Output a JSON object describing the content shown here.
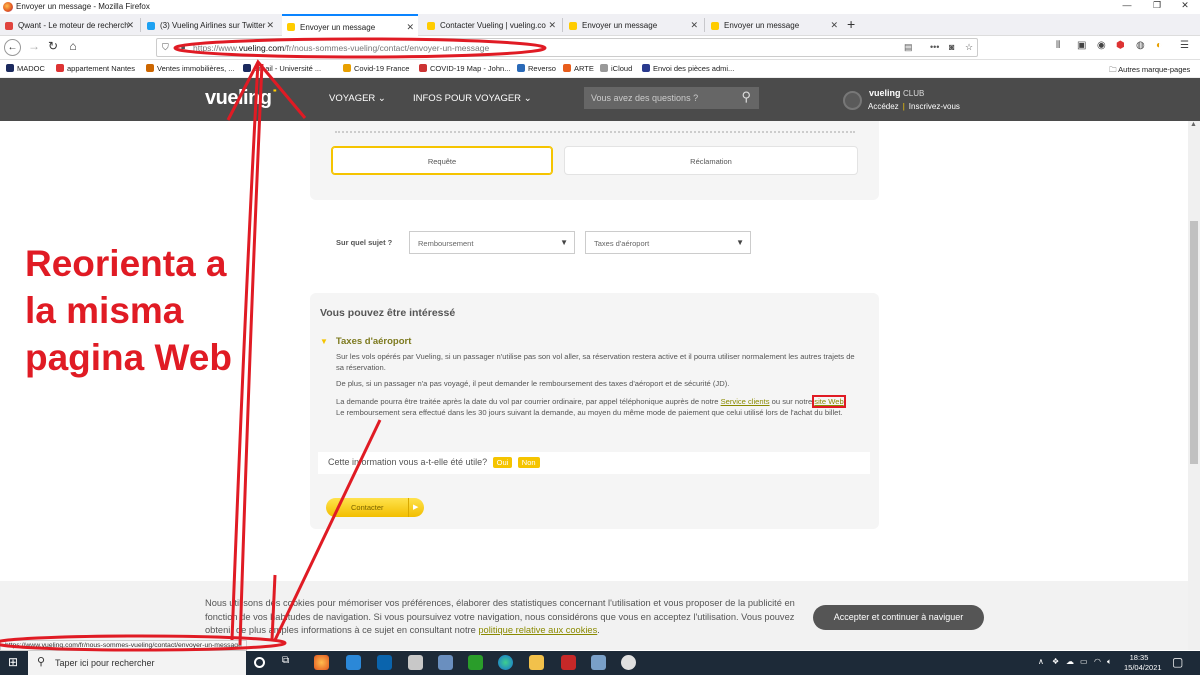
{
  "window": {
    "title": "Envoyer un message - Mozilla Firefox"
  },
  "tabs": [
    {
      "label": "Qwant - Le moteur de recherch",
      "active": false,
      "icon_color": "#e0443e"
    },
    {
      "label": "(3) Vueling Airlines sur Twitter",
      "active": false,
      "icon_color": "#1da1f2"
    },
    {
      "label": "Envoyer un message",
      "active": true,
      "icon_color": "#ffcc00"
    },
    {
      "label": "Contacter Vueling | vueling.co",
      "active": false,
      "icon_color": "#ffcc00"
    },
    {
      "label": "Envoyer un message",
      "active": false,
      "icon_color": "#ffcc00"
    },
    {
      "label": "Envoyer un message",
      "active": false,
      "icon_color": "#ffcc00"
    }
  ],
  "urlbar": {
    "prefix": "https://www.",
    "domain": "vueling.com",
    "path": "/fr/nous-sommes-vueling/contact/envoyer-un-message"
  },
  "bookmarks": [
    {
      "label": "MADOC",
      "color": "#1b2a5e"
    },
    {
      "label": "appartement Nantes",
      "color": "#d33"
    },
    {
      "label": "Ventes immobilières, ...",
      "color": "#c60"
    },
    {
      "label": "Email - Université ...",
      "color": "#1b2a5e"
    },
    {
      "label": "Covid-19 France",
      "color": "#e8a000"
    },
    {
      "label": "COVID-19 Map - John...",
      "color": "#c33"
    },
    {
      "label": "Reverso",
      "color": "#2a6ab8"
    },
    {
      "label": "ARTE",
      "color": "#e85d1c"
    },
    {
      "label": "iCloud",
      "color": "#999"
    },
    {
      "label": "Envoi des pièces admi...",
      "color": "#2a3a8e"
    }
  ],
  "bookmarks_other": "Autres marque-pages",
  "site": {
    "logo": "vueling",
    "menu": [
      "VOYAGER",
      "INFOS POUR VOYAGER"
    ],
    "search_placeholder": "Vous avez des questions ?",
    "club_brand": "vueling",
    "club_suffix": "CLUB",
    "login": "Accédez",
    "register": "Inscrivez-vous"
  },
  "form": {
    "tab_request": "Requête",
    "tab_claim": "Réclamation",
    "subject_label": "Sur quel sujet ?",
    "subject_value": "Remboursement",
    "subsubject_value": "Taxes d'aéroport"
  },
  "info": {
    "title": "Vous pouvez être intéressé",
    "accordion_title": "Taxes d'aéroport",
    "p1": "Sur les vols opérés par Vueling, si un passager n'utilise pas son vol aller, sa réservation restera active et il pourra utiliser normalement les autres trajets de sa réservation.",
    "p2": "De plus, si un passager n'a pas voyagé, il peut demander le remboursement des taxes d'aéroport et de sécurité (JD).",
    "p3_a": "La demande pourra être traitée après la date du vol par courrier ordinaire, par appel téléphonique auprès de notre ",
    "p3_link1": "Service clients",
    "p3_b": " ou sur notre ",
    "p3_link2": "site Web",
    "p3_c": ". Le remboursement sera effectué dans les 30 jours suivant la demande, au moyen du même mode de paiement que celui utilisé lors de l'achat du billet.",
    "feedback_q": "Cette information vous a-t-elle été utile?",
    "yes": "Oui",
    "no": "Non",
    "contact_btn": "Contacter"
  },
  "cookie": {
    "text": "Nous utilisons des cookies pour mémoriser vos préférences, élaborer des statistiques concernant l'utilisation et vous proposer de la publicité en fonction de vos habitudes de navigation. Si vous poursuivez votre navigation, nous considérons que vous en acceptez l'utilisation. Vous pouvez obtenir de plus amples informations à ce sujet en consultant notre ",
    "link": "politique relative aux cookies",
    "text_end": ".",
    "accept": "Accepter et continuer à naviguer"
  },
  "status_url": "https://www.vueling.com/fr/nous-sommes-vueling/contact/envoyer-un-message",
  "taskbar": {
    "search": "Taper ici pour rechercher",
    "time": "18:35",
    "date": "15/04/2021",
    "mail_count": "3"
  },
  "annotation": {
    "text": "Reorienta a la misma pagina Web",
    "color": "#e01b24"
  }
}
